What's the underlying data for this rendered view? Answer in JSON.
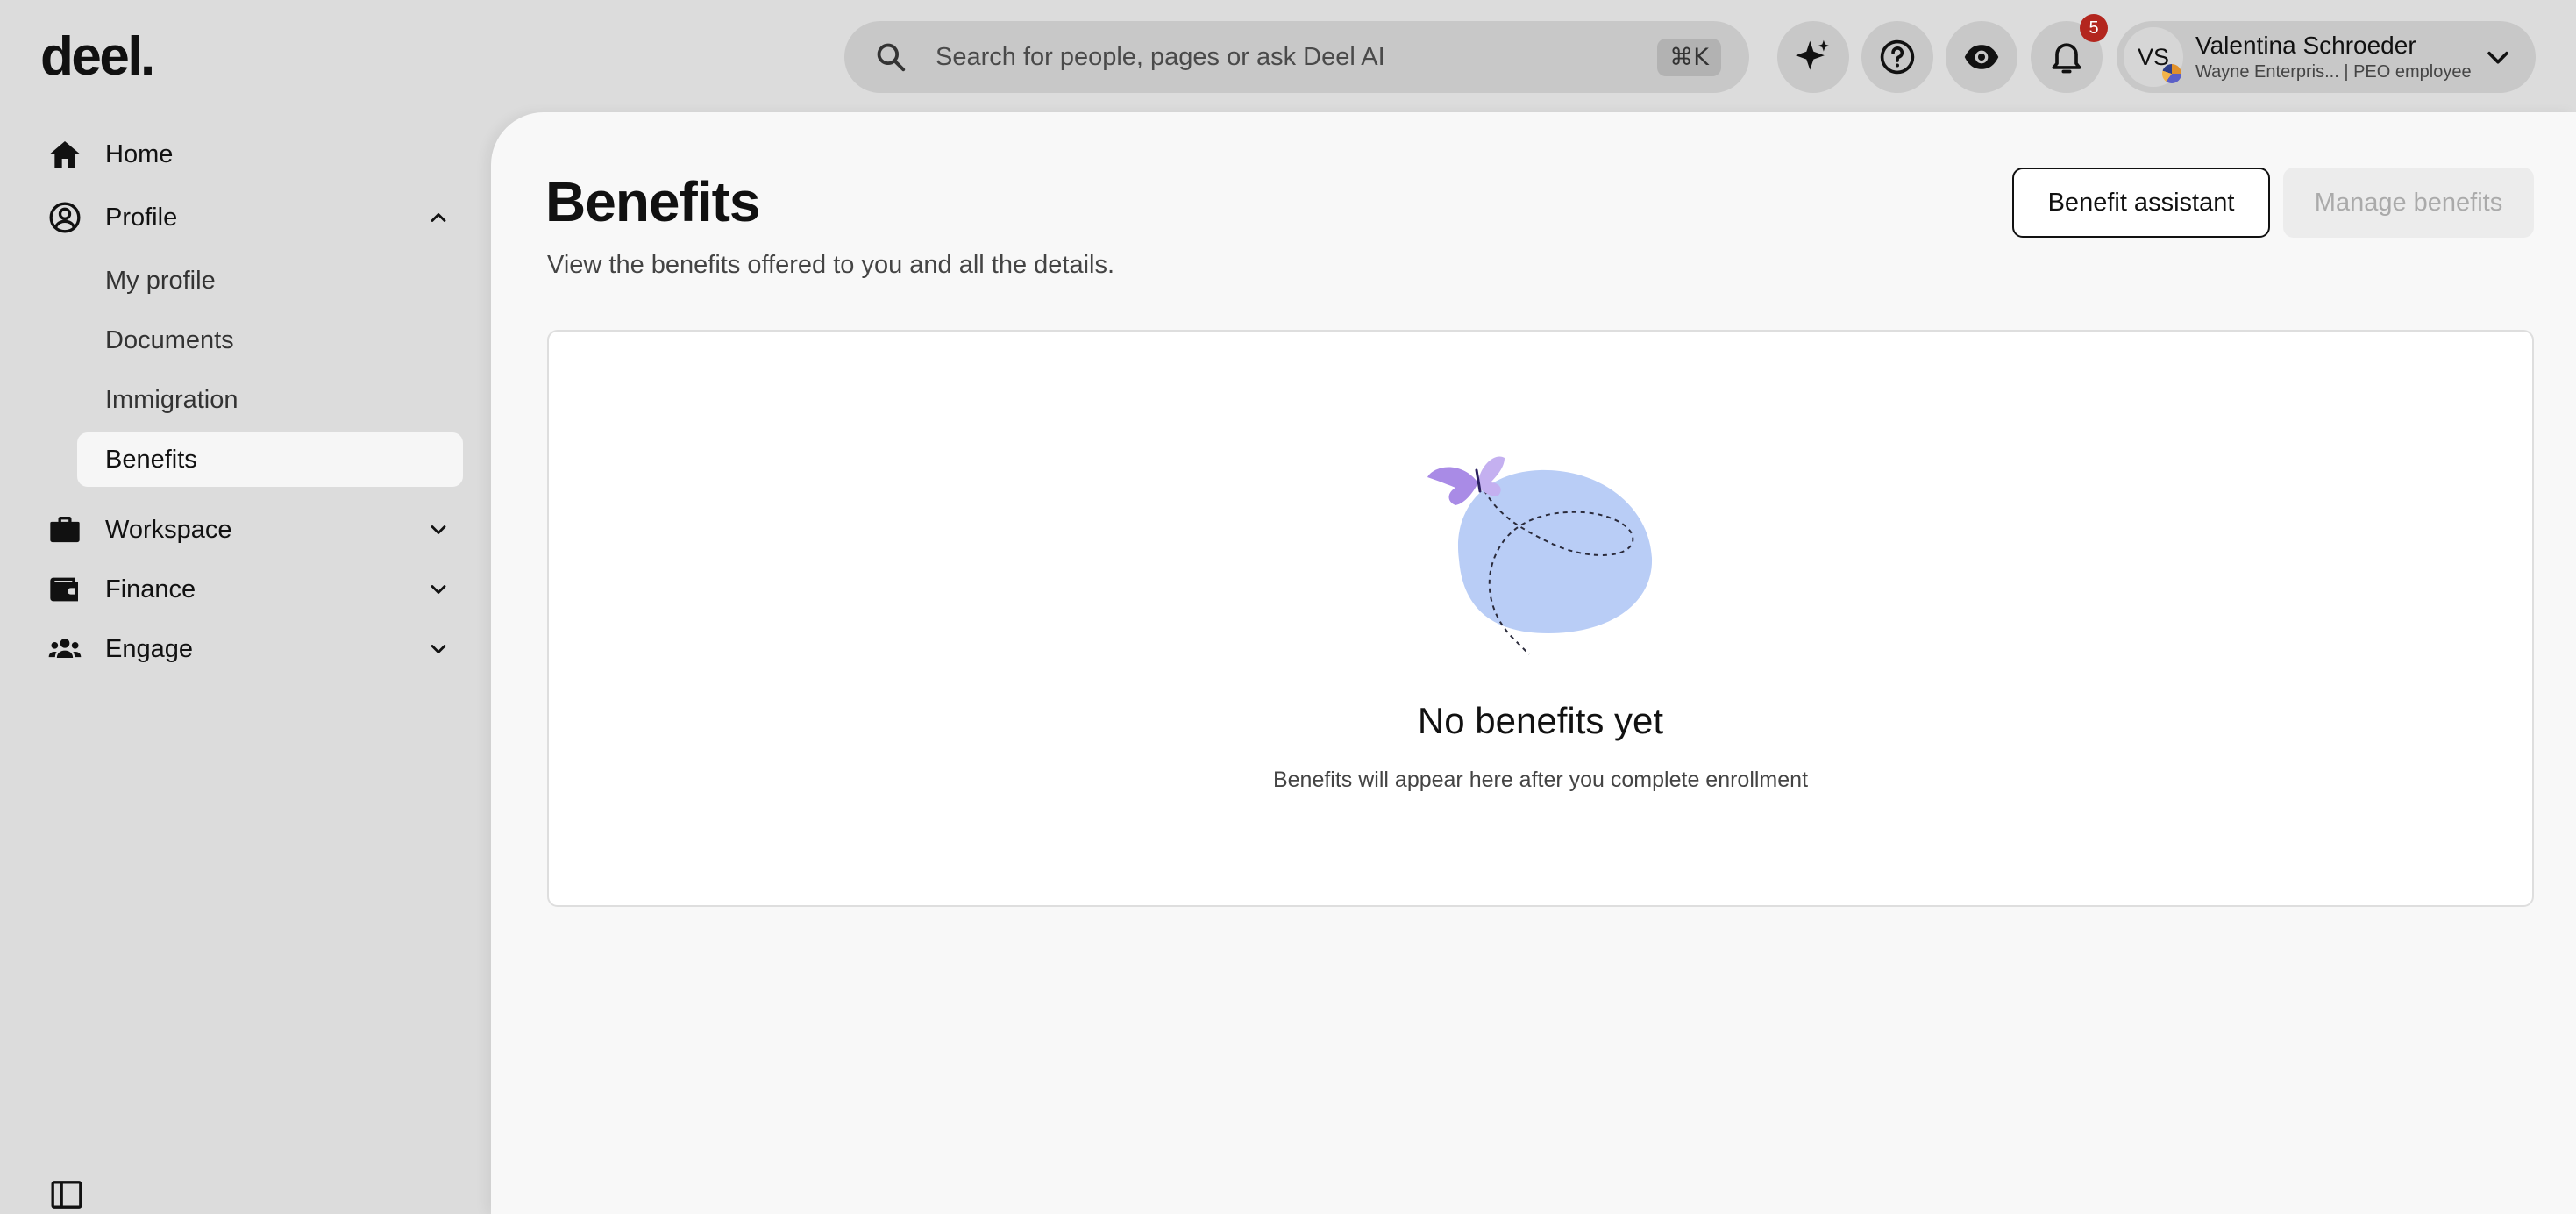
{
  "brand": {
    "logo_text": "deel."
  },
  "search": {
    "placeholder": "Search for people, pages or ask Deel AI",
    "shortcut": "⌘K"
  },
  "header_actions": {
    "ai_icon": "sparkle-icon",
    "help_icon": "question-circle-icon",
    "view_icon": "eye-icon",
    "notifications_icon": "bell-icon",
    "notification_count": "5"
  },
  "user": {
    "initials": "VS",
    "name": "Valentina Schroeder",
    "subtitle": "Wayne Enterpris... | PEO employee"
  },
  "sidebar": {
    "items": [
      {
        "label": "Home",
        "icon": "home-icon"
      },
      {
        "label": "Profile",
        "icon": "user-circle-icon",
        "expanded": true
      },
      {
        "label": "Workspace",
        "icon": "briefcase-icon",
        "expanded": false
      },
      {
        "label": "Finance",
        "icon": "wallet-icon",
        "expanded": false
      },
      {
        "label": "Engage",
        "icon": "people-icon",
        "expanded": false
      }
    ],
    "profile_subitems": [
      {
        "label": "My profile"
      },
      {
        "label": "Documents"
      },
      {
        "label": "Immigration"
      },
      {
        "label": "Benefits",
        "active": true
      }
    ]
  },
  "page": {
    "title": "Benefits",
    "subtitle": "View the benefits offered to you and all the details.",
    "benefit_assistant_label": "Benefit assistant",
    "manage_benefits_label": "Manage benefits"
  },
  "empty_state": {
    "title": "No benefits yet",
    "text": "Benefits will appear here after you complete enrollment"
  },
  "colors": {
    "app_background": "#dcdcdc",
    "content_background": "#f8f8f8",
    "accent_blob": "#b9cdf6",
    "butterfly": "#a98be6",
    "badge": "#b3261e"
  }
}
